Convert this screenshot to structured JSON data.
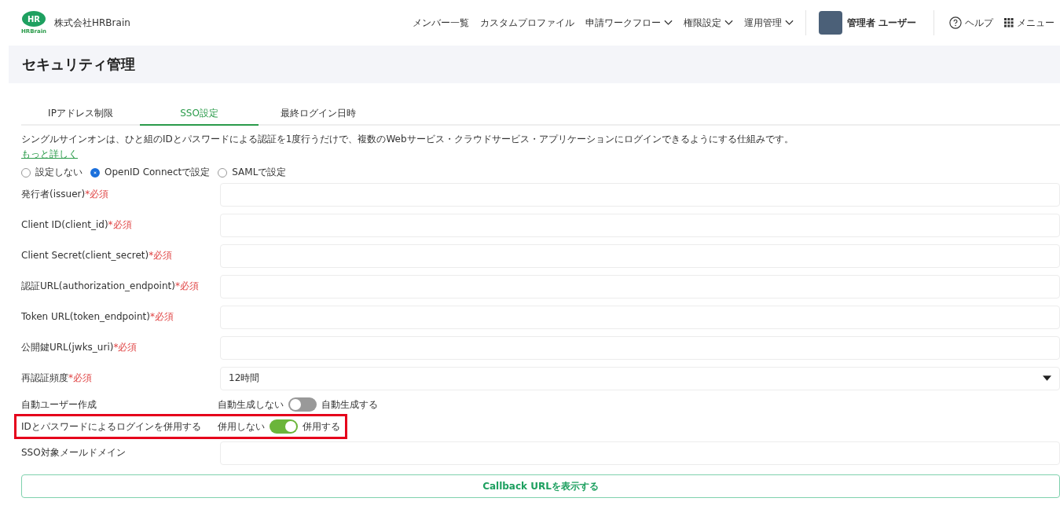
{
  "header": {
    "logo_text": "HR",
    "logo_sub": "HRBrain",
    "company": "株式会社HRBrain",
    "nav": [
      {
        "label": "メンバー一覧",
        "dropdown": false
      },
      {
        "label": "カスタムプロファイル",
        "dropdown": false
      },
      {
        "label": "申請ワークフロー",
        "dropdown": true
      },
      {
        "label": "権限設定",
        "dropdown": true
      },
      {
        "label": "運用管理",
        "dropdown": true
      }
    ],
    "user": "管理者 ユーザー",
    "help": "ヘルプ",
    "menu": "メニュー"
  },
  "page_title": "セキュリティ管理",
  "tabs": [
    {
      "label": "IPアドレス制限",
      "selected": false
    },
    {
      "label": "SSO設定",
      "selected": true
    },
    {
      "label": "最終ログイン日時",
      "selected": false
    }
  ],
  "description": "シングルサインオンは、ひと組のIDとパスワードによる認証を1度行うだけで、複数のWebサービス・クラウドサービス・アプリケーションにログインできるようにする仕組みです。",
  "more_link": "もっと詳しく",
  "radios": [
    {
      "label": "設定しない",
      "selected": false
    },
    {
      "label": "OpenID Connectで設定",
      "selected": true
    },
    {
      "label": "SAMLで設定",
      "selected": false
    }
  ],
  "fields": [
    {
      "kind": "text",
      "label": "発行者(issuer)",
      "required": "*必須",
      "highlighted": false
    },
    {
      "kind": "text",
      "label": "Client ID(client_id)",
      "required": "*必須",
      "highlighted": false
    },
    {
      "kind": "text",
      "label": "Client Secret(client_secret)",
      "required": "*必須",
      "highlighted": false
    },
    {
      "kind": "text",
      "label": "認証URL(authorization_endpoint)",
      "required": "*必須",
      "highlighted": false
    },
    {
      "kind": "text",
      "label": "Token URL(token_endpoint)",
      "required": "*必須",
      "highlighted": false
    },
    {
      "kind": "text",
      "label": "公開鍵URL(jwks_uri)",
      "required": "*必須",
      "highlighted": false
    },
    {
      "kind": "select",
      "label": "再認証頻度",
      "required": "*必須",
      "value": "12時間",
      "highlighted": false
    },
    {
      "kind": "toggle",
      "label": "自動ユーザー作成",
      "off_label": "自動生成しない",
      "on_label": "自動生成する",
      "on": false,
      "highlighted": false
    },
    {
      "kind": "toggle",
      "label": "IDとパスワードによるログインを併用する",
      "off_label": "併用しない",
      "on_label": "併用する",
      "on": true,
      "highlighted": true
    },
    {
      "kind": "text",
      "label": "SSO対象メールドメイン",
      "highlighted": false
    }
  ],
  "callback_button": "Callback URLを表示する"
}
